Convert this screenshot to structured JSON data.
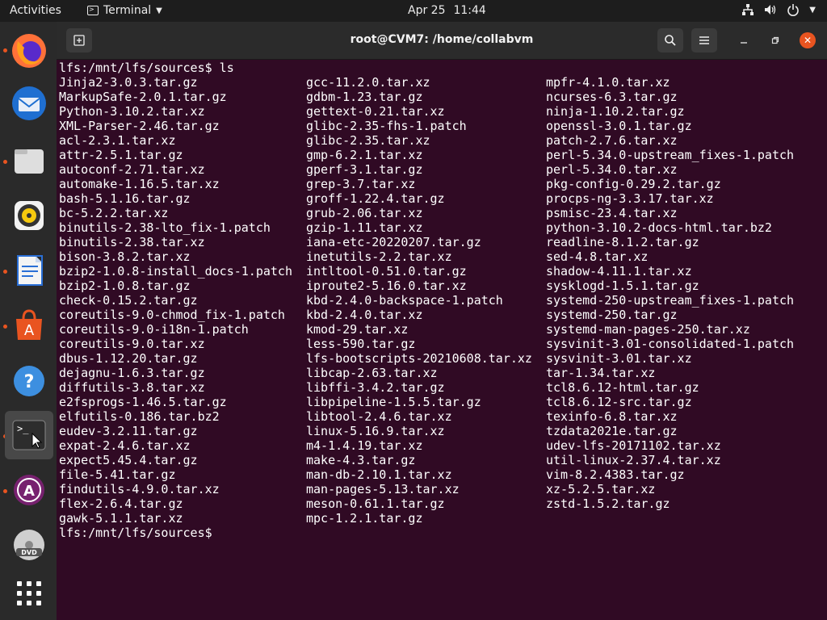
{
  "topbar": {
    "activities": "Activities",
    "app_name": "Terminal",
    "date": "Apr 25",
    "time": "11:44"
  },
  "dock": {
    "items": [
      "firefox",
      "thunderbird",
      "files",
      "rhythmbox",
      "libreoffice-writer",
      "software-center",
      "help",
      "terminal",
      "software-updater",
      "dvd",
      "show-applications"
    ]
  },
  "window": {
    "title": "root@CVM7: /home/collabvm"
  },
  "terminal": {
    "prompt_line": "lfs:/mnt/lfs/sources$ ls",
    "final_prompt": "lfs:/mnt/lfs/sources$",
    "columns": [
      [
        "Jinja2-3.0.3.tar.gz",
        "MarkupSafe-2.0.1.tar.gz",
        "Python-3.10.2.tar.xz",
        "XML-Parser-2.46.tar.gz",
        "acl-2.3.1.tar.xz",
        "attr-2.5.1.tar.gz",
        "autoconf-2.71.tar.xz",
        "automake-1.16.5.tar.xz",
        "bash-5.1.16.tar.gz",
        "bc-5.2.2.tar.xz",
        "binutils-2.38-lto_fix-1.patch",
        "binutils-2.38.tar.xz",
        "bison-3.8.2.tar.xz",
        "bzip2-1.0.8-install_docs-1.patch",
        "bzip2-1.0.8.tar.gz",
        "check-0.15.2.tar.gz",
        "coreutils-9.0-chmod_fix-1.patch",
        "coreutils-9.0-i18n-1.patch",
        "coreutils-9.0.tar.xz",
        "dbus-1.12.20.tar.gz",
        "dejagnu-1.6.3.tar.gz",
        "diffutils-3.8.tar.xz",
        "e2fsprogs-1.46.5.tar.gz",
        "elfutils-0.186.tar.bz2",
        "eudev-3.2.11.tar.gz",
        "expat-2.4.6.tar.xz",
        "expect5.45.4.tar.gz",
        "file-5.41.tar.gz",
        "findutils-4.9.0.tar.xz",
        "flex-2.6.4.tar.gz",
        "gawk-5.1.1.tar.xz"
      ],
      [
        "gcc-11.2.0.tar.xz",
        "gdbm-1.23.tar.gz",
        "gettext-0.21.tar.xz",
        "glibc-2.35-fhs-1.patch",
        "glibc-2.35.tar.xz",
        "gmp-6.2.1.tar.xz",
        "gperf-3.1.tar.gz",
        "grep-3.7.tar.xz",
        "groff-1.22.4.tar.gz",
        "grub-2.06.tar.xz",
        "gzip-1.11.tar.xz",
        "iana-etc-20220207.tar.gz",
        "inetutils-2.2.tar.xz",
        "intltool-0.51.0.tar.gz",
        "iproute2-5.16.0.tar.xz",
        "kbd-2.4.0-backspace-1.patch",
        "kbd-2.4.0.tar.xz",
        "kmod-29.tar.xz",
        "less-590.tar.gz",
        "lfs-bootscripts-20210608.tar.xz",
        "libcap-2.63.tar.xz",
        "libffi-3.4.2.tar.gz",
        "libpipeline-1.5.5.tar.gz",
        "libtool-2.4.6.tar.xz",
        "linux-5.16.9.tar.xz",
        "m4-1.4.19.tar.xz",
        "make-4.3.tar.gz",
        "man-db-2.10.1.tar.xz",
        "man-pages-5.13.tar.xz",
        "meson-0.61.1.tar.gz",
        "mpc-1.2.1.tar.gz"
      ],
      [
        "mpfr-4.1.0.tar.xz",
        "ncurses-6.3.tar.gz",
        "ninja-1.10.2.tar.gz",
        "openssl-3.0.1.tar.gz",
        "patch-2.7.6.tar.xz",
        "perl-5.34.0-upstream_fixes-1.patch",
        "perl-5.34.0.tar.xz",
        "pkg-config-0.29.2.tar.gz",
        "procps-ng-3.3.17.tar.xz",
        "psmisc-23.4.tar.xz",
        "python-3.10.2-docs-html.tar.bz2",
        "readline-8.1.2.tar.gz",
        "sed-4.8.tar.xz",
        "shadow-4.11.1.tar.xz",
        "sysklogd-1.5.1.tar.gz",
        "systemd-250-upstream_fixes-1.patch",
        "systemd-250.tar.gz",
        "systemd-man-pages-250.tar.xz",
        "sysvinit-3.01-consolidated-1.patch",
        "sysvinit-3.01.tar.xz",
        "tar-1.34.tar.xz",
        "tcl8.6.12-html.tar.gz",
        "tcl8.6.12-src.tar.gz",
        "texinfo-6.8.tar.xz",
        "tzdata2021e.tar.gz",
        "udev-lfs-20171102.tar.xz",
        "util-linux-2.37.4.tar.xz",
        "vim-8.2.4383.tar.gz",
        "xz-5.2.5.tar.xz",
        "zstd-1.5.2.tar.gz"
      ]
    ]
  },
  "colors": {
    "terminal_bg": "#300a24",
    "accent": "#e95420"
  }
}
